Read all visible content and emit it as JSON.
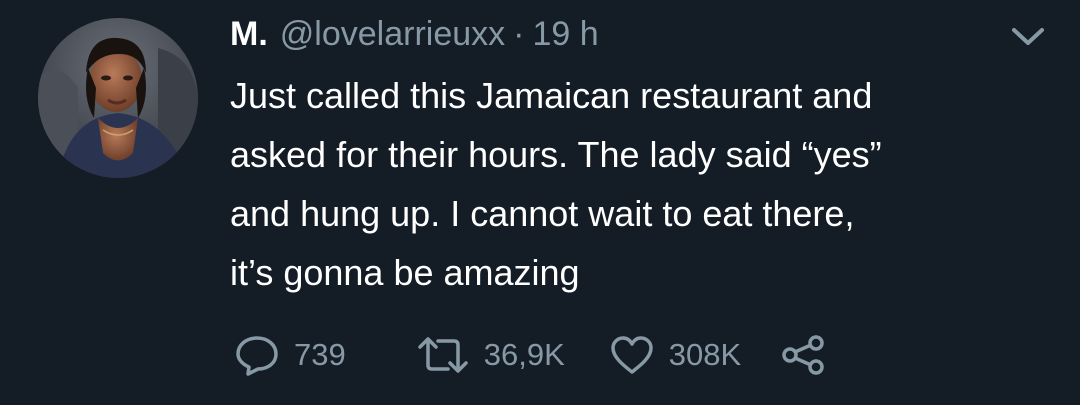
{
  "tweet": {
    "display_name": "M.",
    "handle": "@lovelarrieuxx",
    "separator": "·",
    "time": "19 h",
    "text_lines": [
      "Just called this Jamaican restaurant and",
      "asked for their hours. The lady said “yes”",
      "and hung up. I cannot wait to eat there,",
      "it’s gonna be amazing"
    ],
    "actions": {
      "reply": {
        "icon": "reply-icon",
        "count": "739"
      },
      "retweet": {
        "icon": "retweet-icon",
        "count": "36,9K"
      },
      "like": {
        "icon": "heart-icon",
        "count": "308K"
      },
      "share": {
        "icon": "share-icon"
      }
    },
    "menu_icon": "chevron-down-icon"
  },
  "colors": {
    "background": "#141d26",
    "primary_text": "#ffffff",
    "secondary_text": "#8899a6"
  }
}
